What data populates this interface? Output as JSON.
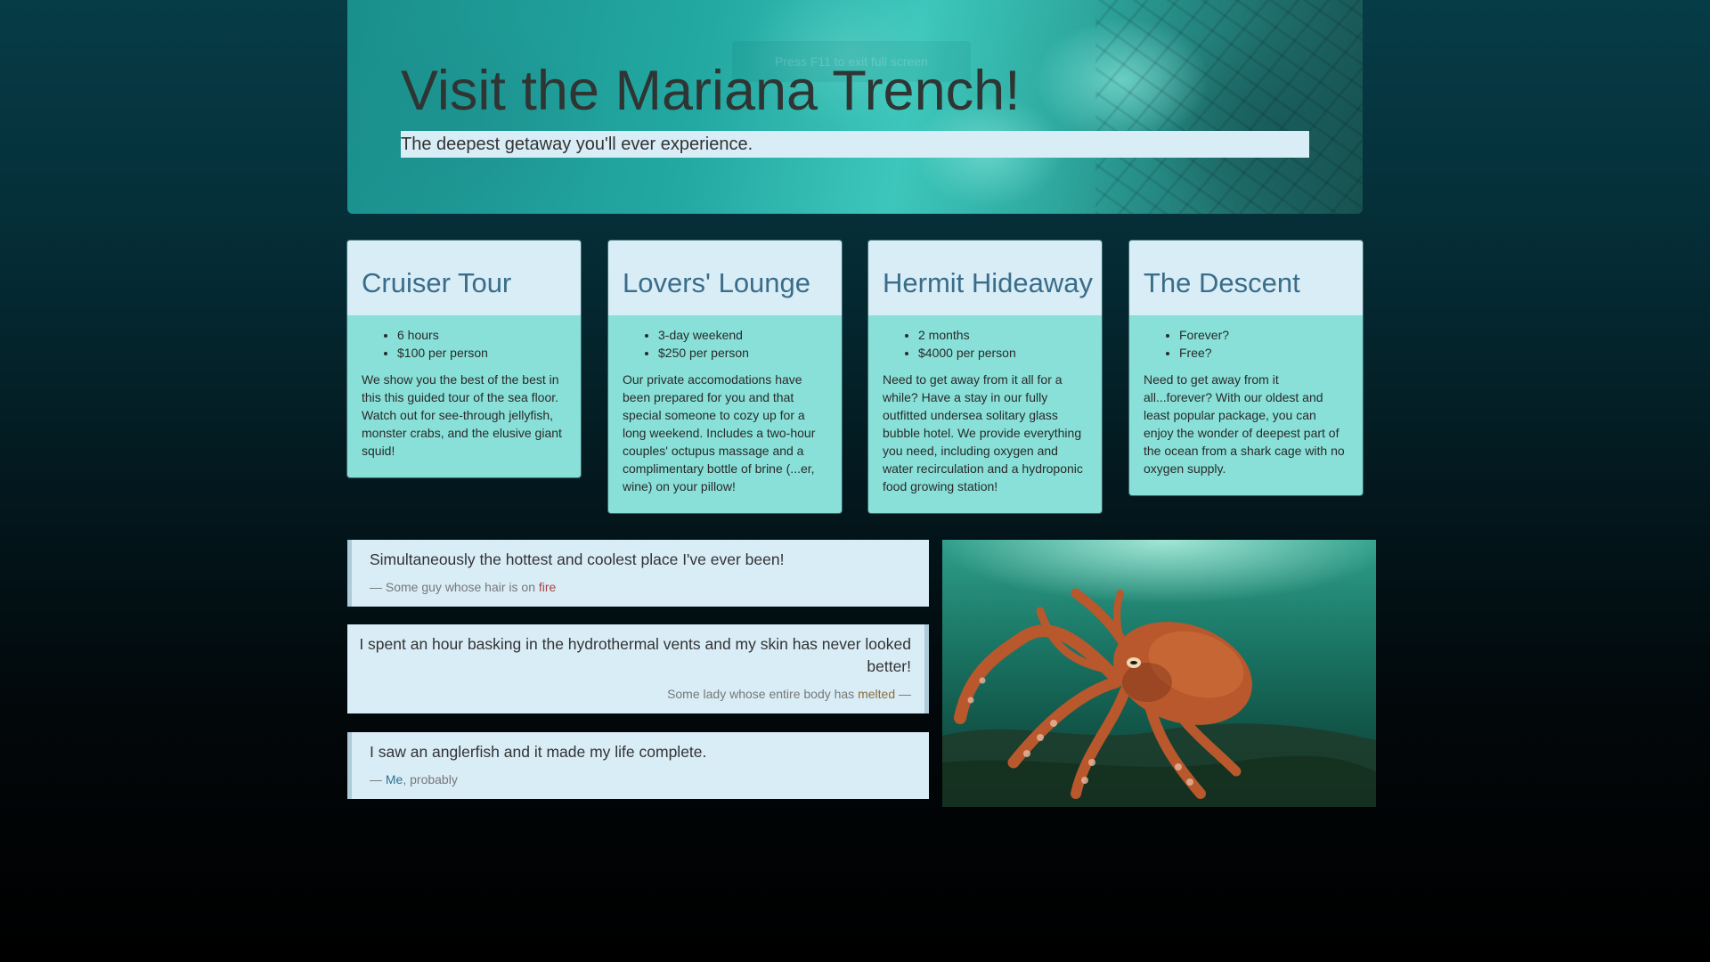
{
  "overlay": {
    "fullscreen_hint": "Press  F11  to exit full screen"
  },
  "hero": {
    "title": "Visit the Mariana Trench!",
    "subtitle": "The deepest getaway you'll ever experience."
  },
  "packages": [
    {
      "title": "Cruiser Tour",
      "details": [
        "6 hours",
        "$100 per person"
      ],
      "description": "We show you the best of the best in this this guided tour of the sea floor. Watch out for see-through jellyfish, monster crabs, and the elusive giant squid!"
    },
    {
      "title": "Lovers' Lounge",
      "details": [
        "3-day weekend",
        "$250 per person"
      ],
      "description": "Our private accomodations have been prepared for you and that special someone to cozy up for a long weekend. Includes a two-hour couples' octupus massage and a complimentary bottle of brine (...er, wine) on your pillow!"
    },
    {
      "title": "Hermit Hideaway",
      "details": [
        "2 months",
        "$4000 per person"
      ],
      "description": "Need to get away from it all for a while? Have a stay in our fully outfitted undersea solitary glass bubble hotel. We provide everything you need, including oxygen and water recirculation and a hydroponic food growing station!"
    },
    {
      "title": "The Descent",
      "details": [
        "Forever?",
        "Free?"
      ],
      "description": "Need to get away from it all...forever? With our oldest and least popular package, you can enjoy the wonder of deepest part of the ocean from a shark cage with no oxygen supply."
    }
  ],
  "testimonials": [
    {
      "quote": "Simultaneously the hottest and coolest place I've ever been!",
      "prefix": "— Some guy whose hair is on ",
      "highlight": "fire",
      "suffix": ""
    },
    {
      "quote": "I spent an hour basking in the hydrothermal vents and my skin has never looked better!",
      "prefix": "Some lady whose entire body has ",
      "highlight": "melted",
      "suffix": " —"
    },
    {
      "quote": "I saw an anglerfish and it made my life complete.",
      "prefix": "— ",
      "highlight": "Me",
      "suffix": ", probably"
    }
  ],
  "photo": {
    "subject": "octopus",
    "colors": {
      "octopus_body": "#b8582c",
      "octopus_dark": "#7a3418",
      "water": "#1c7a68"
    }
  },
  "colors": {
    "panel_light": "#d9edf7",
    "card_teal": "#88e0d8",
    "card_title": "#3a6d8a"
  }
}
